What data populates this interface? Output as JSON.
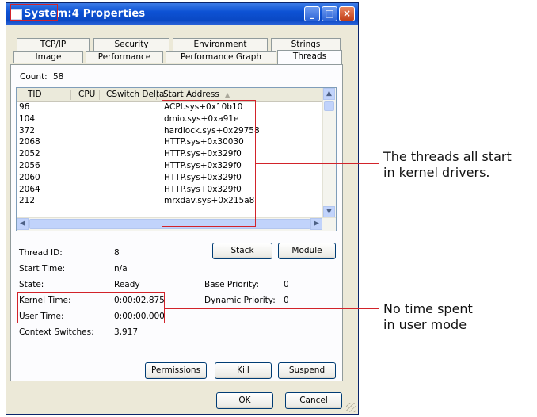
{
  "window": {
    "title": "System:4 Properties",
    "buttons": {
      "minimize": "_",
      "maximize": "□",
      "close": "×"
    }
  },
  "tabs": {
    "row1": [
      "TCP/IP",
      "Security",
      "Environment",
      "Strings"
    ],
    "row2": [
      "Image",
      "Performance",
      "Performance Graph",
      "Threads"
    ],
    "active": "Threads"
  },
  "count": {
    "label": "Count:",
    "value": "58"
  },
  "threads_table": {
    "columns": [
      "TID",
      "CPU",
      "CSwitch Delta",
      "Start Address"
    ],
    "sort_indicator": "▲",
    "rows": [
      {
        "tid": "96",
        "start": "ACPI.sys+0x10b10"
      },
      {
        "tid": "104",
        "start": "dmio.sys+0xa91e"
      },
      {
        "tid": "372",
        "start": "hardlock.sys+0x29758"
      },
      {
        "tid": "2068",
        "start": "HTTP.sys+0x30030"
      },
      {
        "tid": "2052",
        "start": "HTTP.sys+0x329f0"
      },
      {
        "tid": "2056",
        "start": "HTTP.sys+0x329f0"
      },
      {
        "tid": "2060",
        "start": "HTTP.sys+0x329f0"
      },
      {
        "tid": "2064",
        "start": "HTTP.sys+0x329f0"
      },
      {
        "tid": "212",
        "start": "mrxdav.sys+0x215a8"
      }
    ]
  },
  "details": {
    "thread_id": {
      "label": "Thread ID:",
      "value": "8"
    },
    "start_time": {
      "label": "Start Time:",
      "value": "n/a"
    },
    "state": {
      "label": "State:",
      "value": "Ready"
    },
    "base_priority": {
      "label": "Base Priority:",
      "value": "0"
    },
    "kernel_time": {
      "label": "Kernel Time:",
      "value": "0:00:02.875"
    },
    "dynamic_priority": {
      "label": "Dynamic Priority:",
      "value": "0"
    },
    "user_time": {
      "label": "User Time:",
      "value": "0:00:00.000"
    },
    "context_switches": {
      "label": "Context Switches:",
      "value": "3,917"
    }
  },
  "buttons": {
    "stack": "Stack",
    "module": "Module",
    "permissions": "Permissions",
    "kill": "Kill",
    "suspend": "Suspend",
    "ok": "OK",
    "cancel": "Cancel"
  },
  "annotations": {
    "threads_line1": "The threads all start",
    "threads_line2": "in kernel drivers.",
    "user_line1": "No time spent",
    "user_line2": "in user mode"
  },
  "colors": {
    "highlight": "#d2232a",
    "title_bar": "#0a48c4",
    "dialog": "#ece9d8"
  }
}
